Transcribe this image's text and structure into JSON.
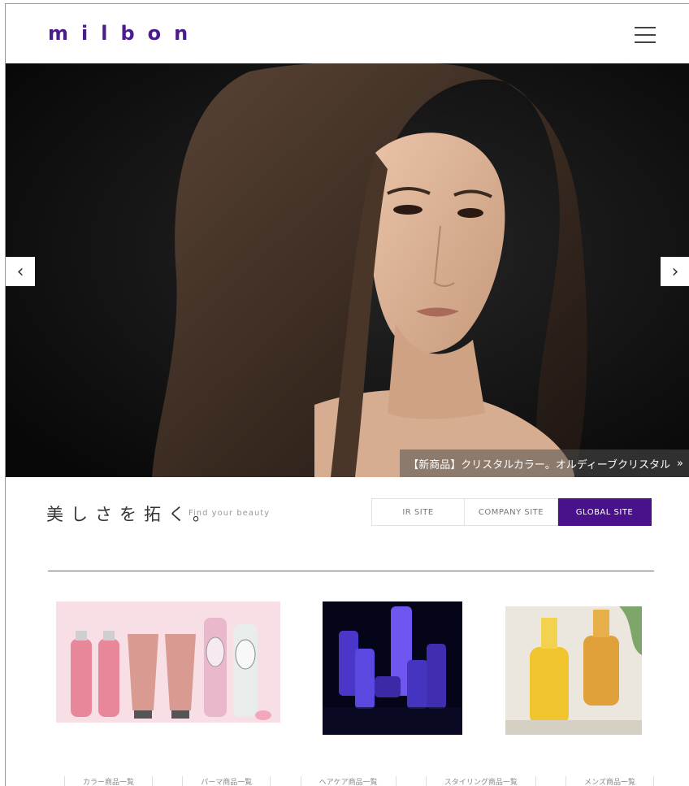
{
  "header": {
    "logo": "milbon",
    "menu_icon": "hamburger-menu-icon"
  },
  "hero": {
    "prev_arrow": "‹",
    "next_arrow": "›",
    "caption": "【新商品】クリスタルカラー。オルディーブクリスタル",
    "caption_arrow": "»"
  },
  "tagline": {
    "main": "美しさを拓く。",
    "sub": "Find your beauty"
  },
  "sites": [
    {
      "label": "IR SITE",
      "active": false
    },
    {
      "label": "COMPANY SITE",
      "active": false
    },
    {
      "label": "GLOBAL SITE",
      "active": true
    }
  ],
  "categories": [
    "カラー商品一覧",
    "パーマ商品一覧",
    "ヘアケア商品一覧",
    "スタイリング商品一覧",
    "メンズ商品一覧"
  ],
  "colors": {
    "brand": "#4a128a",
    "hero_bg": "#101010"
  }
}
